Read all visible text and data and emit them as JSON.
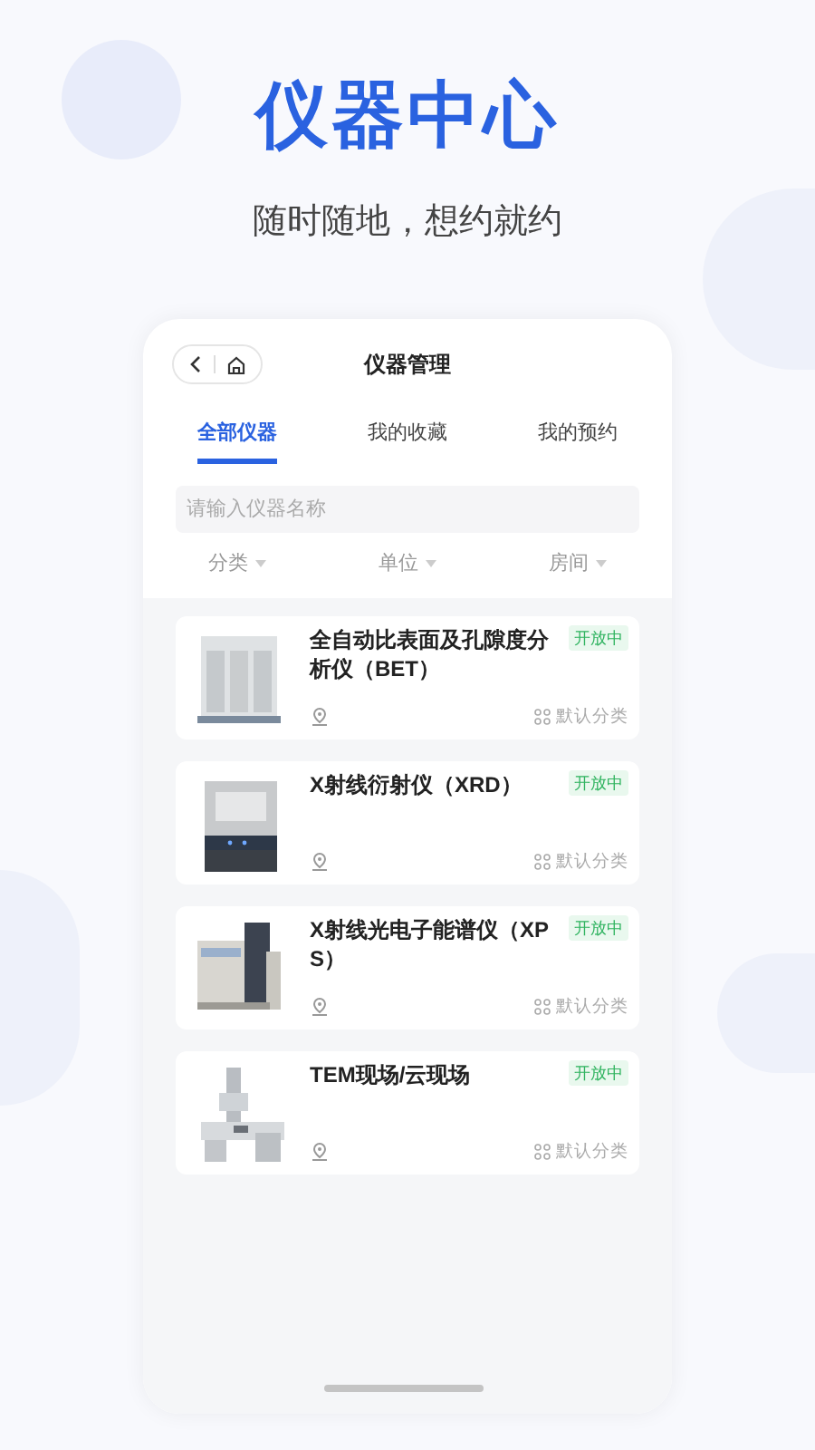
{
  "hero": {
    "title": "仪器中心",
    "subtitle": "随时随地，想约就约"
  },
  "nav": {
    "title": "仪器管理"
  },
  "tabs": [
    {
      "label": "全部仪器",
      "selected": true
    },
    {
      "label": "我的收藏",
      "selected": false
    },
    {
      "label": "我的预约",
      "selected": false
    }
  ],
  "search": {
    "placeholder": "请输入仪器名称"
  },
  "filters": [
    "分类",
    "单位",
    "房间"
  ],
  "instruments": [
    {
      "name": "全自动比表面及孔隙度分析仪（BET）",
      "status": "开放中",
      "category": "默认分类"
    },
    {
      "name": "X射线衍射仪（XRD）",
      "status": "开放中",
      "category": "默认分类"
    },
    {
      "name": "X射线光电子能谱仪（XPS）",
      "status": "开放中",
      "category": "默认分类"
    },
    {
      "name": "TEM现场/云现场",
      "status": "开放中",
      "category": "默认分类"
    }
  ]
}
